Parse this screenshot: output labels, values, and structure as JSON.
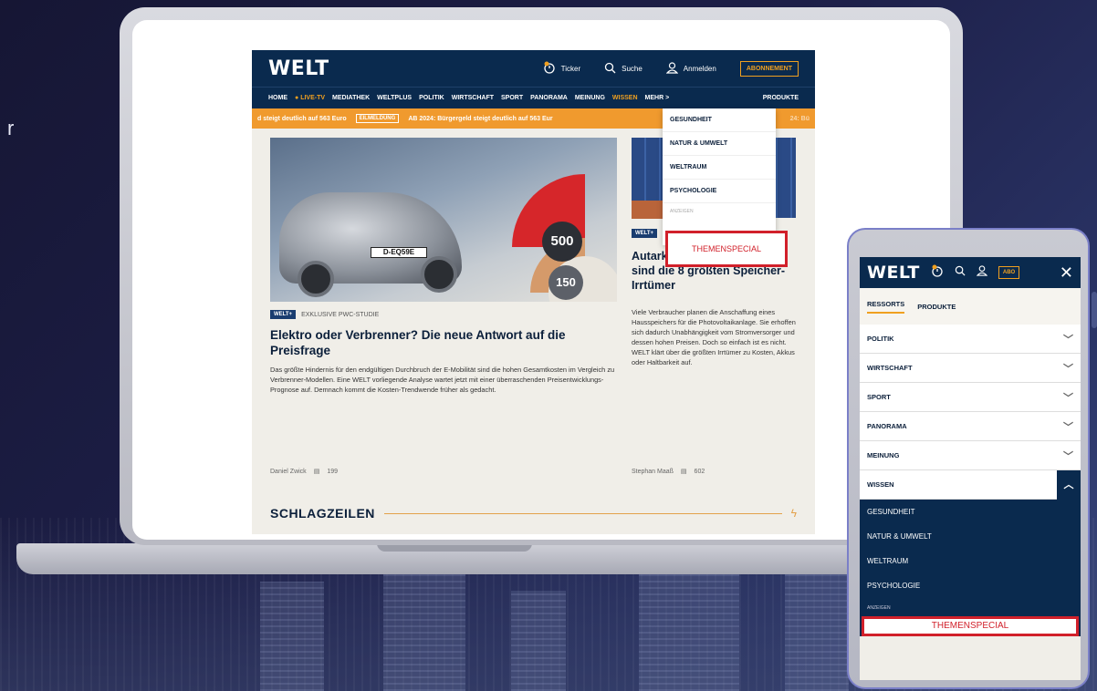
{
  "stray_text": "r",
  "site": {
    "logo": "WELT",
    "top": {
      "ticker": "Ticker",
      "search": "Suche",
      "login": "Anmelden",
      "abo": "ABONNEMENT"
    },
    "nav": [
      "HOME",
      "LIVE-TV",
      "MEDIATHEK",
      "WELTPLUS",
      "POLITIK",
      "WIRTSCHAFT",
      "SPORT",
      "PANORAMA",
      "MEINUNG",
      "WISSEN",
      "MEHR >"
    ],
    "nav_produkte": "PRODUKTE",
    "ticker_bar": {
      "left": "d steigt deutlich auf 563 Euro",
      "tag": "EILMELDUNG",
      "text": "AB 2024: Bürgergeld steigt deutlich auf 563 Eur",
      "right": "24: Bü"
    },
    "dropdown": [
      "GESUNDHEIT",
      "NATUR & UMWELT",
      "WELTRAUM",
      "PSYCHOLOGIE"
    ],
    "dropdown_ads": "ANZEIGEN",
    "themen": "THEMENSPECIAL",
    "hero": {
      "plate": "D-EQ59E",
      "gauge_high": "500",
      "gauge_low": "150",
      "badge": "WELT+",
      "kicker": "EXKLUSIVE PWC-STUDIE",
      "title": "Elektro oder Verbrenner? Die neue Antwort auf die Preisfrage",
      "body": "Das größte Hindernis für den endgültigen Durchbruch der E-Mobilität sind die hohen Gesamtkosten im Vergleich zu Verbrenner-Modellen. Eine WELT vorliegende Analyse wartet jetzt mit einer überraschenden Preisentwicklungs-Prognose auf. Demnach kommt die Kosten-Trendwende früher als gedacht.",
      "author": "Daniel Zwick",
      "comments": "199"
    },
    "side": {
      "badge": "WELT+",
      "title": "Autarkie dank Batterie? Das sind die 8 größten Speicher-Irrtümer",
      "body": "Viele Verbraucher planen die Anschaffung eines Hausspeichers für die Photovoltaikanlage. Sie erhoffen sich dadurch Unabhängigkeit vom Stromversorger und dessen hohen Preisen. Doch so einfach ist es nicht. WELT klärt über die größten Irrtümer zu Kosten, Akkus oder Haltbarkeit auf.",
      "author": "Stephan Maaß",
      "comments": "602"
    },
    "schlagzeilen": "SCHLAGZEILEN"
  },
  "phone": {
    "logo": "WELT",
    "abo": "ABO",
    "tabs": [
      "RESSORTS",
      "PRODUKTE"
    ],
    "rows": [
      "POLITIK",
      "WIRTSCHAFT",
      "SPORT",
      "PANORAMA",
      "MEINUNG"
    ],
    "open_row": "WISSEN",
    "sub": [
      "GESUNDHEIT",
      "NATUR & UMWELT",
      "WELTRAUM",
      "PSYCHOLOGIE"
    ],
    "ads": "ANZEIGEN",
    "themen": "THEMENSPECIAL"
  },
  "colors": {
    "navy": "#0a2a4e",
    "orange": "#f09a2e",
    "highlight_red": "#d1202a"
  }
}
